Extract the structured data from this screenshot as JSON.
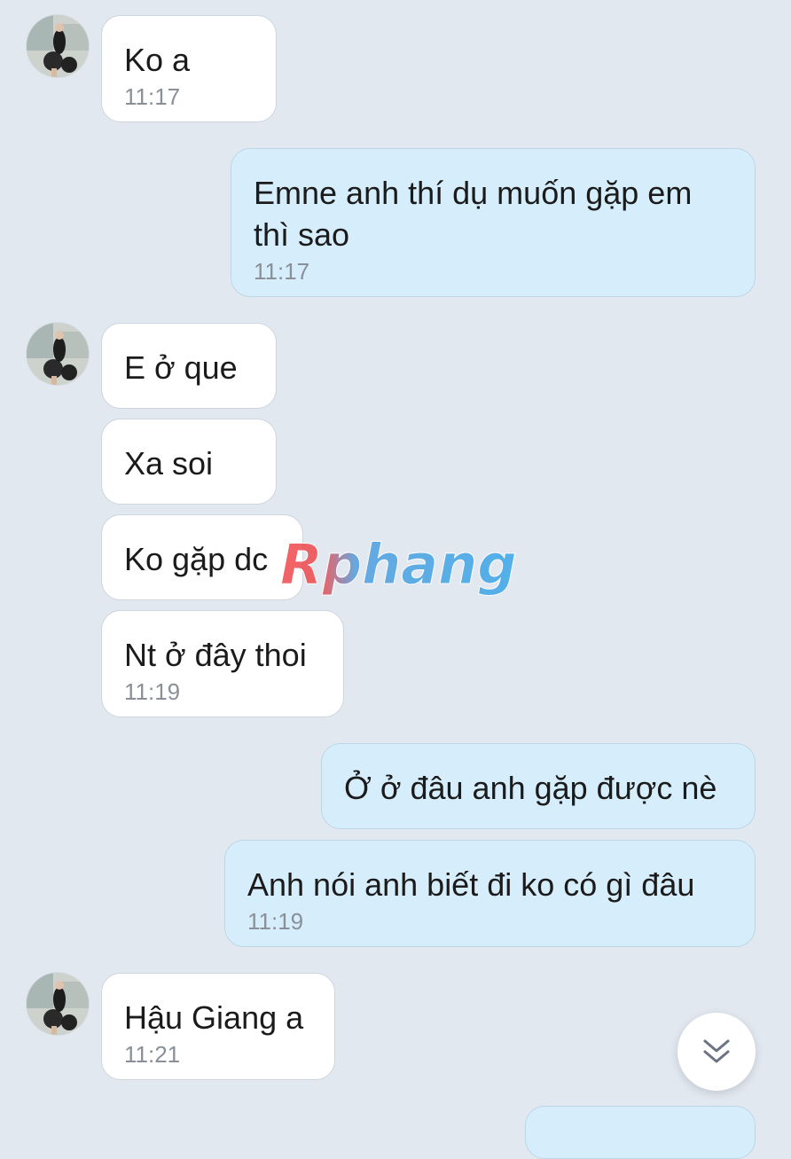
{
  "messages": [
    {
      "text": "Ko a",
      "time": "11:17"
    },
    {
      "text": "Emne anh thí dụ muốn gặp em thì sao",
      "time": "11:17"
    },
    {
      "text": "E ở que"
    },
    {
      "text": "Xa soi"
    },
    {
      "text": "Ko gặp dc"
    },
    {
      "text": "Nt ở đây thoi",
      "time": "11:19"
    },
    {
      "text": "Ở ở đâu anh gặp được nè"
    },
    {
      "text": "Anh nói anh biết đi ko có gì đâu",
      "time": "11:19"
    },
    {
      "text": "Hậu Giang a",
      "time": "11:21"
    }
  ],
  "watermark": {
    "text": "Rphang"
  },
  "colors": {
    "background": "#e2e8f0",
    "incoming_bubble": "#ffffff",
    "outgoing_bubble": "#d6eefc",
    "timestamp": "#8a9098",
    "watermark_red": "#ee4a4e",
    "watermark_blue": "#3aa7e8"
  },
  "icons": {
    "avatar": "contact-avatar-photo",
    "scroll_down": "chevrons-down-icon"
  }
}
